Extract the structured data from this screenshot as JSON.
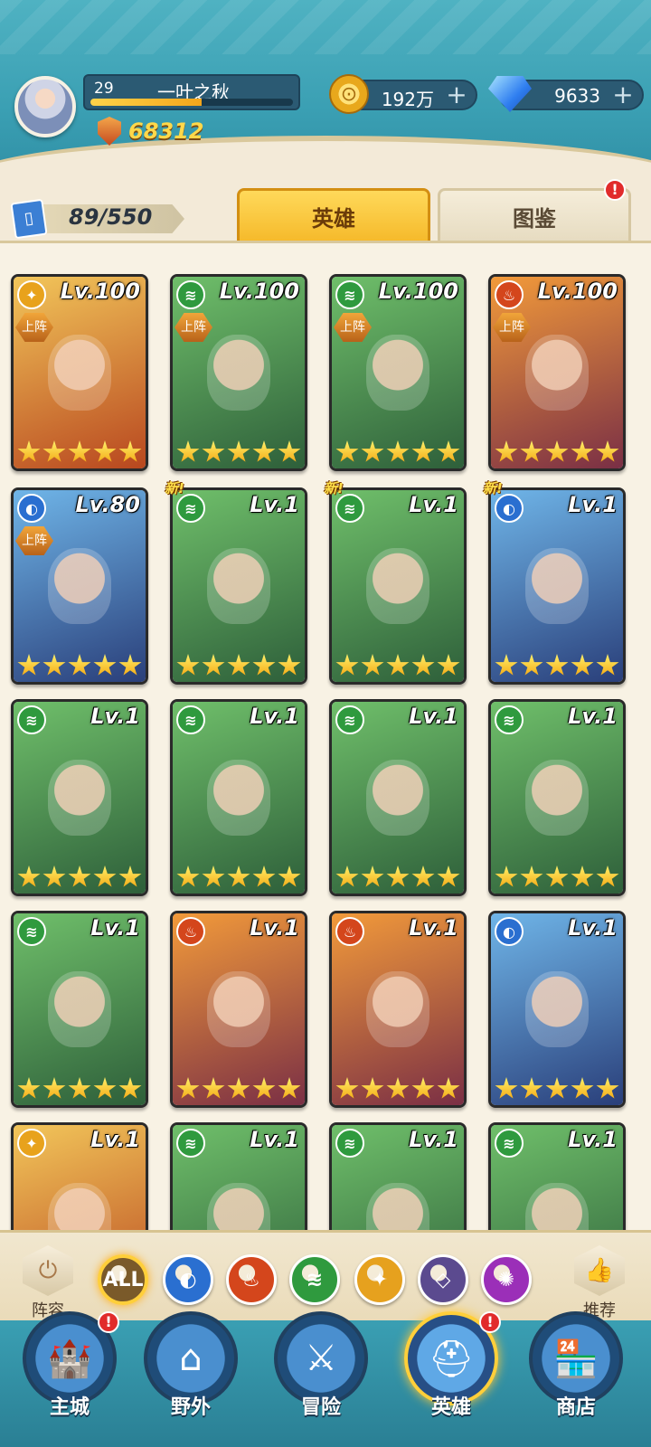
{
  "player": {
    "level": "29",
    "name": "一叶之秋",
    "power": "68312",
    "exp_fraction": 0.55
  },
  "resources": {
    "gold": "192万",
    "gems": "9633",
    "plus": "+"
  },
  "roster": {
    "count": "89/550"
  },
  "tabs": [
    {
      "label": "英雄",
      "active": true
    },
    {
      "label": "图鉴",
      "active": false,
      "badge": "!"
    }
  ],
  "heroes": [
    {
      "level": "Lv.100",
      "element": "light",
      "deployed": "上阵",
      "stars": 5,
      "new": ""
    },
    {
      "level": "Lv.100",
      "element": "wind",
      "deployed": "上阵",
      "stars": 5,
      "new": ""
    },
    {
      "level": "Lv.100",
      "element": "wind",
      "deployed": "上阵",
      "stars": 5,
      "new": ""
    },
    {
      "level": "Lv.100",
      "element": "fire",
      "deployed": "上阵",
      "stars": 5,
      "new": ""
    },
    {
      "level": "Lv.80",
      "element": "water",
      "deployed": "上阵",
      "stars": 5,
      "new": ""
    },
    {
      "level": "Lv.1",
      "element": "wind",
      "deployed": "",
      "stars": 5,
      "new": "新!"
    },
    {
      "level": "Lv.1",
      "element": "wind",
      "deployed": "",
      "stars": 5,
      "new": "新!"
    },
    {
      "level": "Lv.1",
      "element": "water",
      "deployed": "",
      "stars": 5,
      "new": "新!"
    },
    {
      "level": "Lv.1",
      "element": "wind",
      "deployed": "",
      "stars": 5,
      "new": ""
    },
    {
      "level": "Lv.1",
      "element": "wind",
      "deployed": "",
      "stars": 5,
      "new": ""
    },
    {
      "level": "Lv.1",
      "element": "wind",
      "deployed": "",
      "stars": 5,
      "new": ""
    },
    {
      "level": "Lv.1",
      "element": "wind",
      "deployed": "",
      "stars": 5,
      "new": ""
    },
    {
      "level": "Lv.1",
      "element": "wind",
      "deployed": "",
      "stars": 5,
      "new": ""
    },
    {
      "level": "Lv.1",
      "element": "fire",
      "deployed": "",
      "stars": 5,
      "new": ""
    },
    {
      "level": "Lv.1",
      "element": "fire",
      "deployed": "",
      "stars": 5,
      "new": ""
    },
    {
      "level": "Lv.1",
      "element": "water",
      "deployed": "",
      "stars": 5,
      "new": ""
    },
    {
      "level": "Lv.1",
      "element": "light",
      "deployed": "",
      "stars": 0,
      "new": ""
    },
    {
      "level": "Lv.1",
      "element": "wind",
      "deployed": "",
      "stars": 0,
      "new": ""
    },
    {
      "level": "Lv.1",
      "element": "wind",
      "deployed": "",
      "stars": 0,
      "new": ""
    },
    {
      "level": "Lv.1",
      "element": "wind",
      "deployed": "",
      "stars": 0,
      "new": ""
    }
  ],
  "filters": {
    "lineup_label": "阵容",
    "recommend_label": "推荐",
    "elements": [
      {
        "id": "all",
        "label": "ALL",
        "color": "#7a5a2a",
        "active": true
      },
      {
        "id": "water",
        "label": "",
        "color": "#2a6fd0"
      },
      {
        "id": "fire",
        "label": "",
        "color": "#d4461c"
      },
      {
        "id": "wind",
        "label": "",
        "color": "#2f9a3e"
      },
      {
        "id": "light",
        "label": "",
        "color": "#e6a11e"
      },
      {
        "id": "dark",
        "label": "",
        "color": "#5b4a8f"
      },
      {
        "id": "arcane",
        "label": "",
        "color": "#9b2fb8"
      }
    ]
  },
  "nav": [
    {
      "label": "主城",
      "icon": "castle-icon",
      "badge": "!"
    },
    {
      "label": "野外",
      "icon": "portal-icon",
      "badge": ""
    },
    {
      "label": "冒险",
      "icon": "sword-icon",
      "badge": ""
    },
    {
      "label": "英雄",
      "icon": "helmet-icon",
      "badge": "!",
      "active": true
    },
    {
      "label": "商店",
      "icon": "shop-icon",
      "badge": ""
    }
  ],
  "element_colors": {
    "light": "#e8a21c",
    "wind": "#2f9a3e",
    "fire": "#d4461c",
    "water": "#2a6fd0"
  }
}
